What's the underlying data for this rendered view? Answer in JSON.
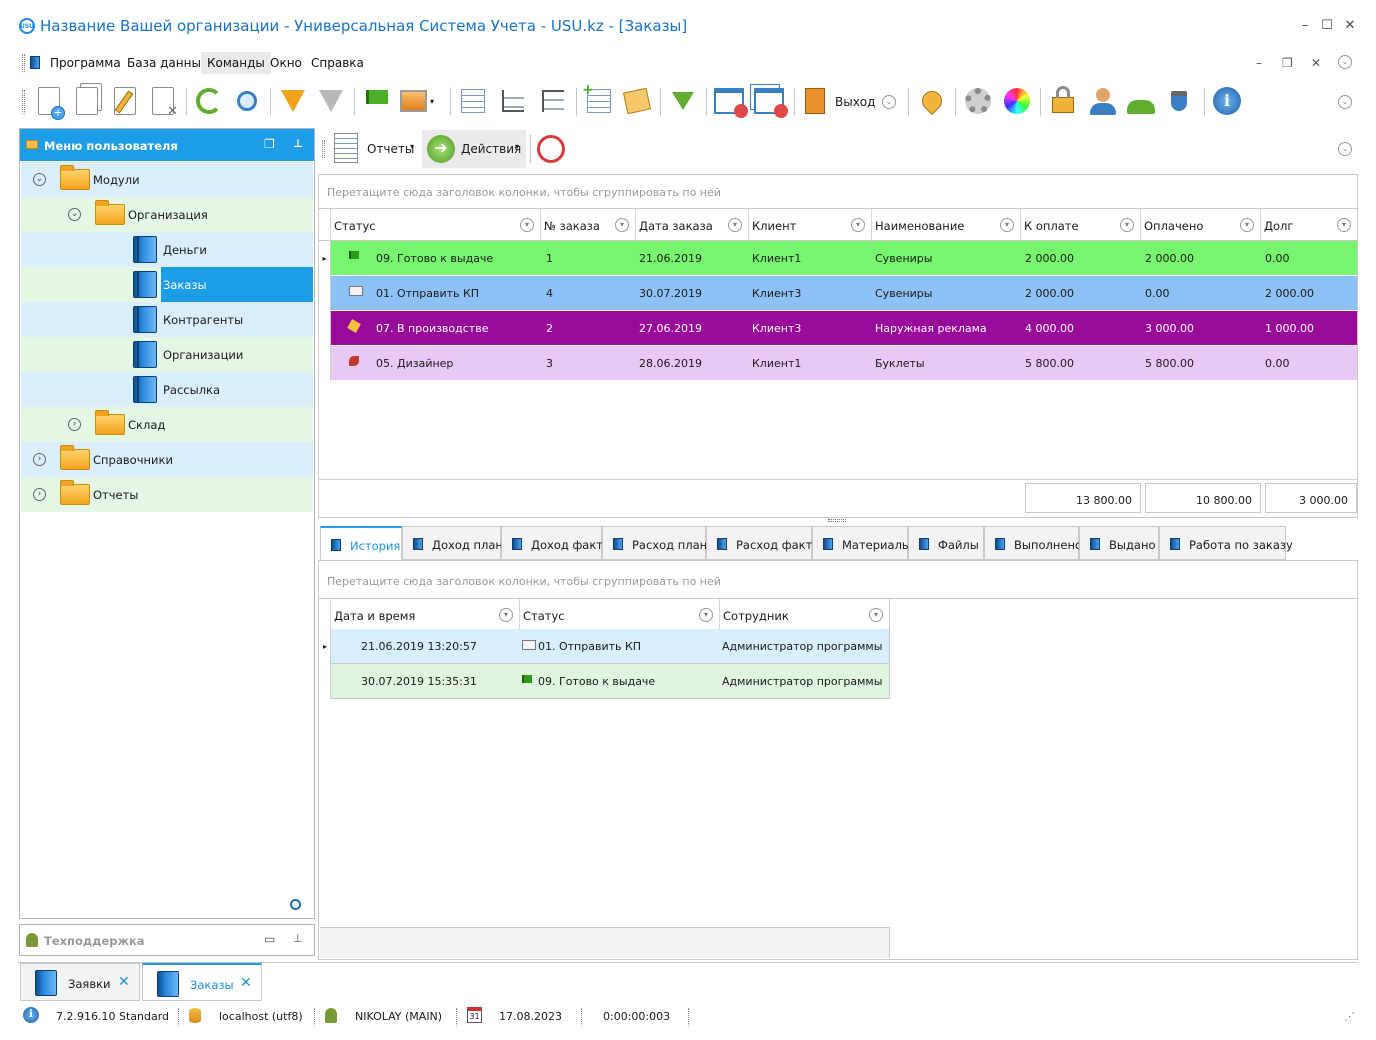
{
  "window": {
    "title": "Название Вашей организации - Универсальная Система Учета - USU.kz - [Заказы]",
    "logo": "USU"
  },
  "menu": [
    "Программа",
    "База данных",
    "Команды",
    "Окно",
    "Справка"
  ],
  "toolbar": {
    "exit_label": "Выход"
  },
  "left_panel": {
    "title": "Меню пользователя",
    "tree": [
      {
        "label": "Модули",
        "type": "folder",
        "level": 0,
        "expanded": true
      },
      {
        "label": "Организация",
        "type": "folder",
        "level": 1,
        "expanded": true
      },
      {
        "label": "Деньги",
        "type": "book",
        "level": 2
      },
      {
        "label": "Заказы",
        "type": "book",
        "level": 2,
        "selected": true
      },
      {
        "label": "Контрагенты",
        "type": "book",
        "level": 2
      },
      {
        "label": "Организации",
        "type": "book",
        "level": 2
      },
      {
        "label": "Рассылка",
        "type": "book",
        "level": 2
      },
      {
        "label": "Склад",
        "type": "folder",
        "level": 1,
        "expanded": false
      },
      {
        "label": "Справочники",
        "type": "folder",
        "level": 0,
        "expanded": false
      },
      {
        "label": "Отчеты",
        "type": "folder",
        "level": 0,
        "expanded": false
      }
    ],
    "support_title": "Техподдержка"
  },
  "main_toolbar": {
    "reports_label": "Отчеты",
    "actions_label": "Действия"
  },
  "orders_grid": {
    "group_hint": "Перетащите сюда заголовок колонки, чтобы сгруппировать по ней",
    "columns": [
      "Статус",
      "№ заказа",
      "Дата заказа",
      "Клиент",
      "Наименование",
      "К оплате",
      "Оплачено",
      "Долг"
    ],
    "rows": [
      {
        "status": "09. Готово к выдаче",
        "icon": "flag-icon",
        "number": "1",
        "date": "21.06.2019",
        "client": "Клиент1",
        "name": "Сувениры",
        "to_pay": "2 000.00",
        "paid": "2 000.00",
        "debt": "0.00",
        "color": "#78f56e",
        "text_color": "#1a1a1a"
      },
      {
        "status": "01. Отправить КП",
        "icon": "envelope-icon",
        "number": "4",
        "date": "30.07.2019",
        "client": "Клиент3",
        "name": "Сувениры",
        "to_pay": "2 000.00",
        "paid": "0.00",
        "debt": "2 000.00",
        "color": "#8ec2f7",
        "text_color": "#1a1a1a"
      },
      {
        "status": "07. В производстве",
        "icon": "hammer-icon",
        "number": "2",
        "date": "27.06.2019",
        "client": "Клиент3",
        "name": "Наружная реклама",
        "to_pay": "4 000.00",
        "paid": "3 000.00",
        "debt": "1 000.00",
        "color": "#9a0a9a",
        "text_color": "#ffffff"
      },
      {
        "status": "05. Дизайнер",
        "icon": "designer-icon",
        "number": "3",
        "date": "28.06.2019",
        "client": "Клиент1",
        "name": "Буклеты",
        "to_pay": "5 800.00",
        "paid": "5 800.00",
        "debt": "0.00",
        "color": "#e8c8f5",
        "text_color": "#1a1a1a"
      }
    ],
    "totals": {
      "to_pay": "13 800.00",
      "paid": "10 800.00",
      "debt": "3 000.00"
    }
  },
  "detail_tabs": [
    "История",
    "Доход план",
    "Доход факт",
    "Расход план",
    "Расход факт",
    "Материалы",
    "Файлы",
    "Выполнено",
    "Выдано",
    "Работа по заказу"
  ],
  "history_grid": {
    "group_hint": "Перетащите сюда заголовок колонки, чтобы сгруппировать по ней",
    "columns": [
      "Дата и время",
      "Статус",
      "Сотрудник"
    ],
    "rows": [
      {
        "datetime": "21.06.2019 13:20:57",
        "status": "01. Отправить КП",
        "icon": "envelope-icon",
        "employee": "Администратор программы",
        "color": "#d9eefc"
      },
      {
        "datetime": "30.07.2019 15:35:31",
        "status": "09. Готово к выдаче",
        "icon": "flag-icon",
        "employee": "Администратор программы",
        "color": "#dff5df"
      }
    ]
  },
  "doc_tabs": [
    {
      "label": "Заявки",
      "active": false
    },
    {
      "label": "Заказы",
      "active": true
    }
  ],
  "status_bar": {
    "version": "7.2.916.10 Standard",
    "database": "localhost (utf8)",
    "user": "NIKOLAY (MAIN)",
    "date": "17.08.2023",
    "timer": "0:00:00:003",
    "calendar_day": "31"
  }
}
